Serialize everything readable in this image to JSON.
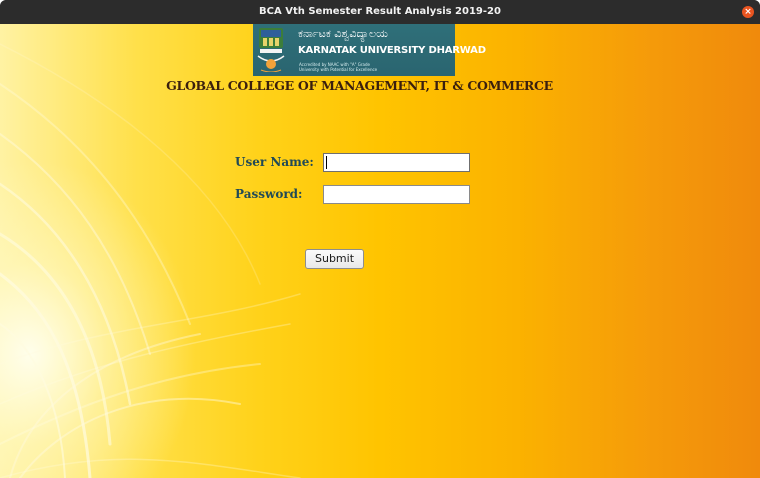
{
  "window": {
    "title": "BCA Vth Semester Result Analysis 2019-20",
    "close_glyph": "×"
  },
  "logo": {
    "kannada_name": "ಕರ್ನಾಟಕ ವಿಶ್ವವಿದ್ಯಾಲಯ",
    "english_name": "KARNATAK UNIVERSITY DHARWAD",
    "accreditation_line1": "Accredited by NAAC with \"A\" Grade",
    "accreditation_line2": "University with Potential for Excellence"
  },
  "college": {
    "title": "GLOBAL COLLEGE OF MANAGEMENT, IT & COMMERCE"
  },
  "form": {
    "username_label": "User Name:",
    "username_value": "",
    "password_label": "Password:",
    "password_value": "",
    "submit_label": "Submit"
  },
  "colors": {
    "titlebar": "#2c2c2c",
    "close_button": "#e95420",
    "banner": "#2f6f79",
    "college_title": "#3a1f0e",
    "label": "#214a57"
  },
  "icons": {
    "close": "close-icon",
    "emblem": "university-emblem-icon"
  }
}
